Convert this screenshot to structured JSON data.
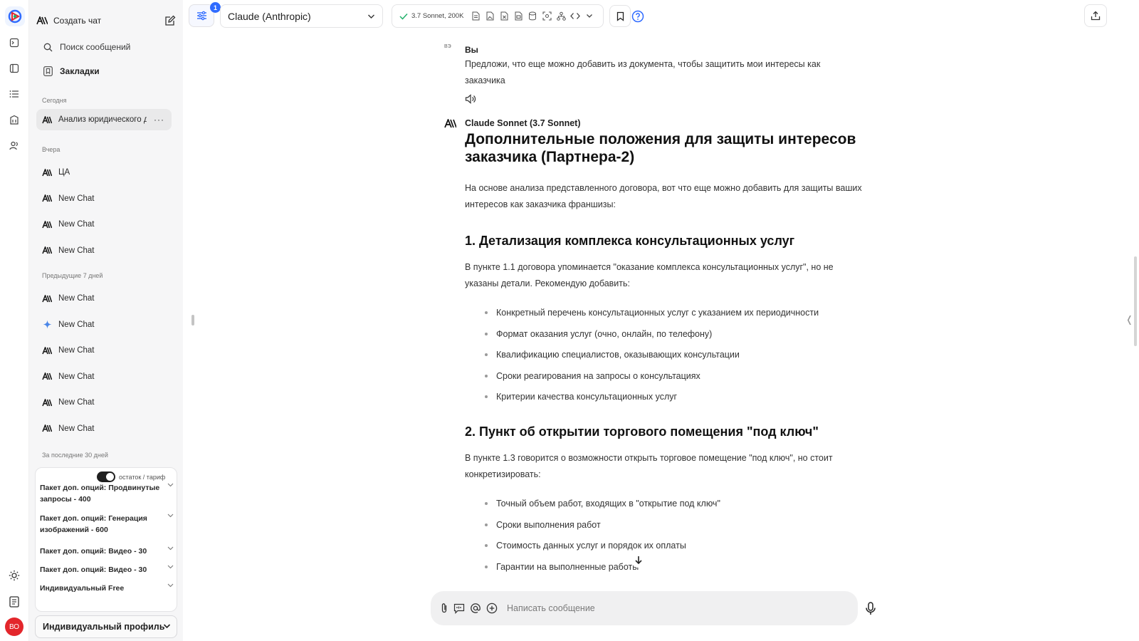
{
  "sidebar": {
    "create_chat": "Создать чат",
    "search_label": "Поиск сообщений",
    "bookmarks_label": "Закладки",
    "sections": {
      "today": "Сегодня",
      "yesterday": "Вчера",
      "prev7": "Предыдущие 7 дней",
      "last30": "За последние 30 дней"
    },
    "chats_today": [
      {
        "label": "Анализ юридического документа",
        "icon": "anthropic-icon"
      }
    ],
    "chats_yesterday": [
      {
        "label": "ЦА",
        "icon": "anthropic-icon"
      },
      {
        "label": "New Chat",
        "icon": "anthropic-icon"
      },
      {
        "label": "New Chat",
        "icon": "anthropic-icon"
      },
      {
        "label": "New Chat",
        "icon": "anthropic-icon"
      }
    ],
    "chats_prev7": [
      {
        "label": "New Chat",
        "icon": "anthropic-icon"
      },
      {
        "label": "New Chat",
        "icon": "gemini-sparkle-icon"
      },
      {
        "label": "New Chat",
        "icon": "anthropic-icon"
      },
      {
        "label": "New Chat",
        "icon": "anthropic-icon"
      },
      {
        "label": "New Chat",
        "icon": "anthropic-icon"
      },
      {
        "label": "New Chat",
        "icon": "anthropic-icon"
      }
    ],
    "more_dots": "···",
    "toggle_label": "остаток / тариф",
    "packages": [
      "Пакет доп. опций: Продвинутые запросы - 400",
      "Пакет доп. опций: Генерация изображений - 600",
      "Пакет доп. опций: Видео - 30",
      "Пакет доп. опций: Видео - 30",
      "Индивидуальный Free"
    ],
    "profile_button": "Индивидуальный профиль"
  },
  "rail": {
    "avatar_initials": "ВО",
    "accent": "#e3262b"
  },
  "topbar": {
    "filter_badge": "1",
    "model_name": "Claude (Anthropic)",
    "model_caps": "3.7 Sonnet, 200K",
    "accent": "#2f6bff"
  },
  "message_user": {
    "name": "Вы",
    "avatar_alt": "ВЭ",
    "text": "Предложи, что еще можно добавить из документа, чтобы защитить мои интересы как заказчика"
  },
  "message_assistant": {
    "name": "Claude Sonnet (3.7 Sonnet)",
    "title": "Дополнительные положения для защиты интересов заказчика (Партнера-2)",
    "intro": "На основе анализа представленного договора, вот что еще можно добавить для защиты ваших интересов как заказчика франшизы:",
    "section1": {
      "heading": "1. Детализация комплекса консультационных услуг",
      "text": "В пункте 1.1 договора упоминается \"оказание комплекса консультационных услуг\", но не указаны детали. Рекомендую добавить:",
      "items": [
        "Конкретный перечень консультационных услуг с указанием их периодичности",
        "Формат оказания услуг (очно, онлайн, по телефону)",
        "Квалификацию специалистов, оказывающих консультации",
        "Сроки реагирования на запросы о консультациях",
        "Критерии качества консультационных услуг"
      ]
    },
    "section2": {
      "heading": "2. Пункт об открытии торгового помещения \"под ключ\"",
      "text": "В пункте 1.3 говорится о возможности открыть торговое помещение \"под ключ\", но стоит конкретизировать:",
      "items": [
        "Точный объем работ, входящих в \"открытие под ключ\"",
        "Сроки выполнения работ",
        "Стоимость данных услуг и порядок их оплаты",
        "Гарантии на выполненные работы"
      ]
    }
  },
  "composer": {
    "placeholder": "Написать сообщение"
  }
}
